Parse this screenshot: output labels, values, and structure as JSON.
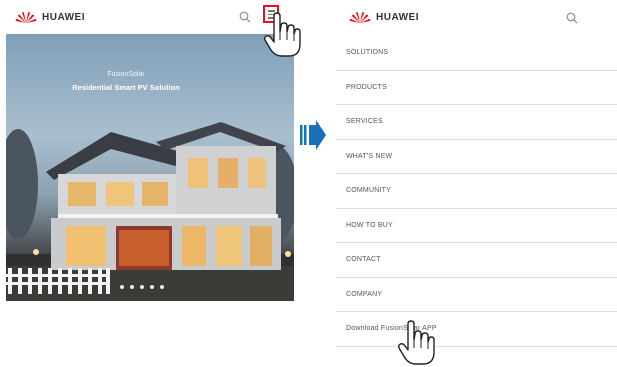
{
  "brand": {
    "name": "HUAWEI",
    "logo_color": "#e8101a"
  },
  "left_screen": {
    "hero_subtitle": "FusionSolar",
    "hero_title": "Residential Smart PV Solution",
    "carousel_dots": 5,
    "highlight_color": "#e8101a"
  },
  "arrow_color": "#1a6fb9",
  "right_screen": {
    "menu_items": [
      {
        "label": "SOLUTIONS"
      },
      {
        "label": "PRODUCTS"
      },
      {
        "label": "SERVICES"
      },
      {
        "label": "WHAT'S NEW"
      },
      {
        "label": "COMMUNITY"
      },
      {
        "label": "HOW TO BUY"
      },
      {
        "label": "CONTACT"
      },
      {
        "label": "COMPANY"
      },
      {
        "label": "Download FusionSolar APP"
      }
    ]
  },
  "icons": [
    "huawei-logo-icon",
    "search-icon",
    "hamburger-menu-icon",
    "hand-pointer-icon",
    "arrow-right-icon"
  ]
}
